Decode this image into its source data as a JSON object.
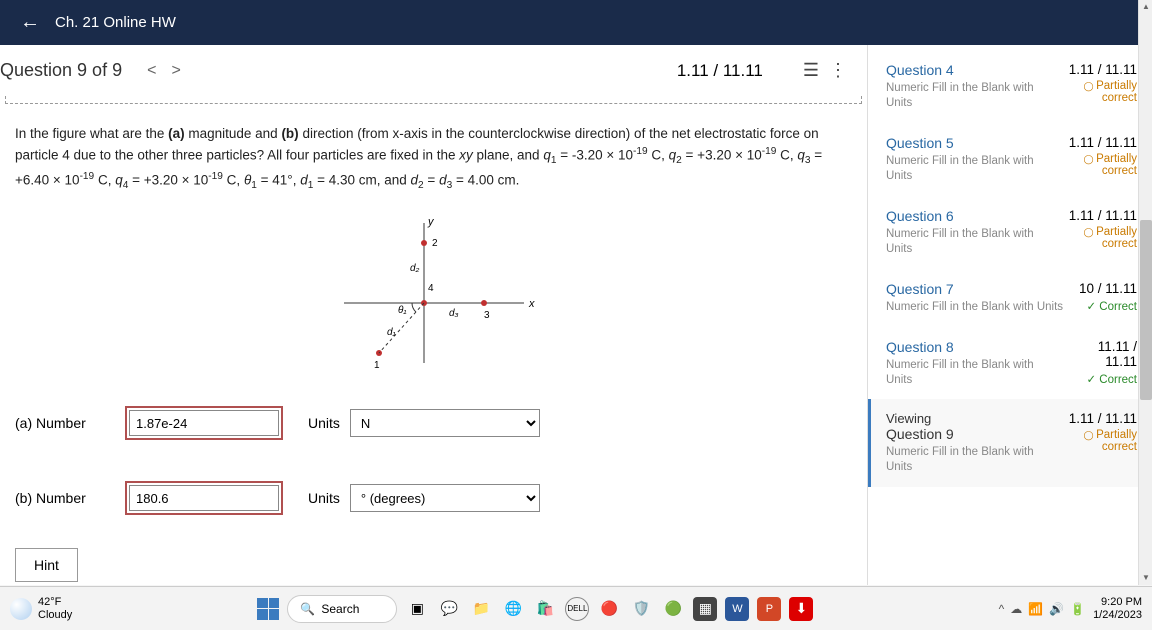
{
  "header": {
    "title": "Ch. 21 Online HW"
  },
  "question": {
    "label": "Question 9 of 9",
    "score": "1.11 / 11.11"
  },
  "problem": {
    "text_html": "In the figure what are the <b>(a)</b> magnitude and <b>(b)</b> direction (from x-axis in the counterclockwise direction) of the net electrostatic force on particle 4 due to the other three particles? All four particles are fixed in the <i>xy</i> plane, and <i>q</i><sub>1</sub> = -3.20 × 10<sup>-19</sup> C, <i>q</i><sub>2</sub> = +3.20 × 10<sup>-19</sup> C, <i>q</i><sub>3</sub> = +6.40 × 10<sup>-19</sup> C, <i>q</i><sub>4</sub> = +3.20 × 10<sup>-19</sup> C, <i>θ</i><sub>1</sub> = 41°, <i>d</i><sub>1</sub> = 4.30 cm, and <i>d</i><sub>2</sub> = <i>d</i><sub>3</sub> = 4.00 cm."
  },
  "answers": {
    "a": {
      "label": "(a)   Number",
      "value": "1.87e-24",
      "units_label": "Units",
      "units_value": "N"
    },
    "b": {
      "label": "(b)   Number",
      "value": "180.6",
      "units_label": "Units",
      "units_value": "° (degrees)"
    }
  },
  "hint_label": "Hint",
  "sidebar": [
    {
      "title": "Question 4",
      "sub": "Numeric Fill in the Blank with Units",
      "score": "1.11 / 11.11",
      "status": "Partially correct",
      "status_class": "partial"
    },
    {
      "title": "Question 5",
      "sub": "Numeric Fill in the Blank with Units",
      "score": "1.11 / 11.11",
      "status": "Partially correct",
      "status_class": "partial"
    },
    {
      "title": "Question 6",
      "sub": "Numeric Fill in the Blank with Units",
      "score": "1.11 / 11.11",
      "status": "Partially correct",
      "status_class": "partial"
    },
    {
      "title": "Question 7",
      "sub": "Numeric Fill in the Blank with Units",
      "score": "10 / 11.11",
      "status": "Correct",
      "status_class": "correct"
    },
    {
      "title": "Question 8",
      "sub": "Numeric Fill in the Blank with Units",
      "score": "11.11 / 11.11",
      "status": "Correct",
      "status_class": "correct"
    },
    {
      "title": "Question 9",
      "viewing": "Viewing",
      "sub": "Numeric Fill in the Blank with Units",
      "score": "1.11 / 11.11",
      "status": "Partially correct",
      "status_class": "partial",
      "active": true
    }
  ],
  "taskbar": {
    "weather": {
      "temp": "42°F",
      "cond": "Cloudy"
    },
    "search": "Search",
    "time": "9:20 PM",
    "date": "1/24/2023"
  }
}
